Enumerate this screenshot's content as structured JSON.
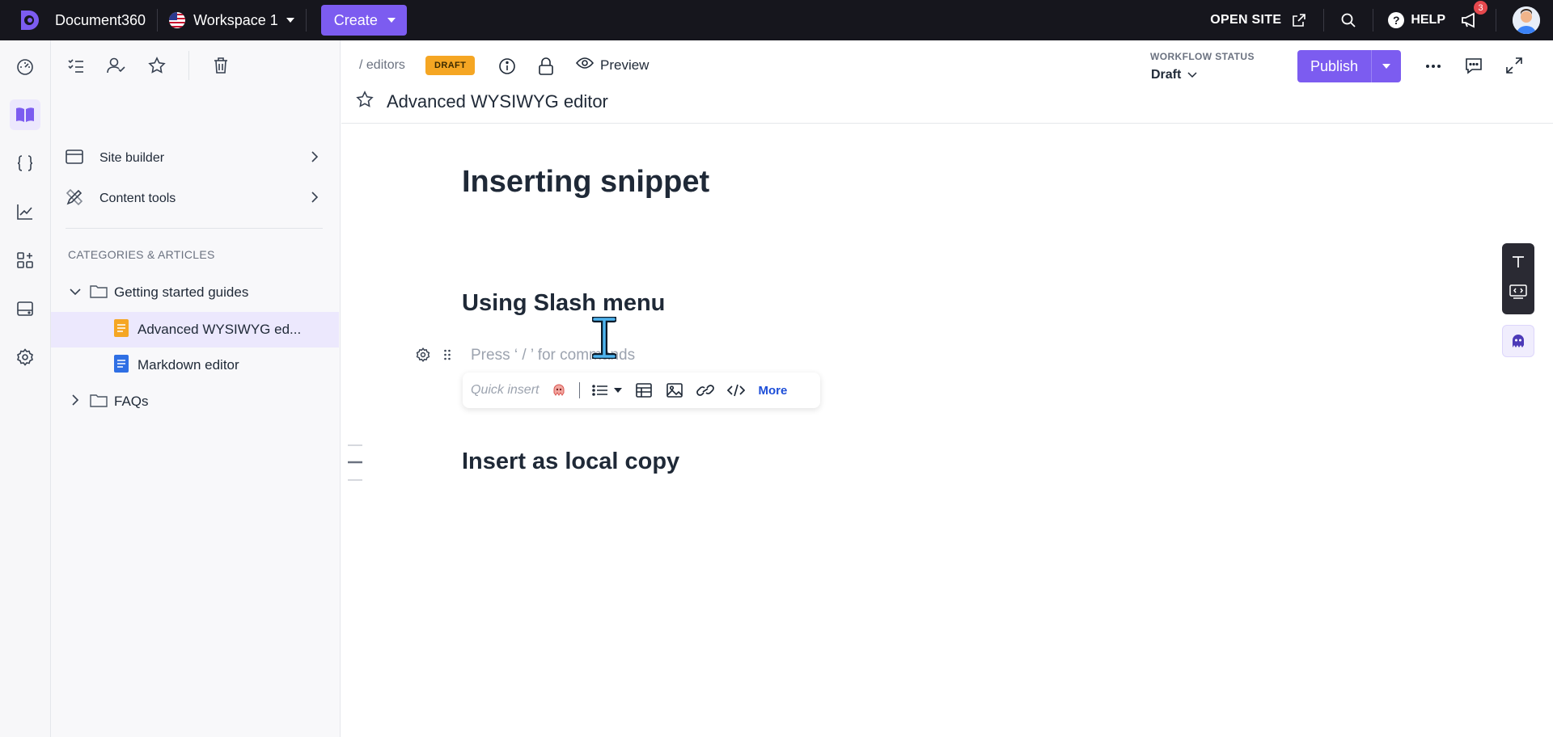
{
  "app": {
    "brand": "Document360",
    "workspace": "Workspace 1",
    "create_label": "Create",
    "open_site_label": "OPEN SITE",
    "help_label": "HELP",
    "notification_count": "3",
    "accent_color": "#7c5cf0"
  },
  "sidebar": {
    "links": [
      {
        "label": "Site builder"
      },
      {
        "label": "Content tools"
      }
    ],
    "categories_heading": "CATEGORIES & ARTICLES",
    "tree": [
      {
        "label": "Getting started guides",
        "expanded": true
      },
      {
        "label": "Advanced WYSIWYG ed...",
        "selected": true
      },
      {
        "label": "Markdown editor"
      },
      {
        "label": "FAQs",
        "expanded": false
      }
    ]
  },
  "header": {
    "breadcrumb": "/ editors",
    "status_badge": "DRAFT",
    "preview_label": "Preview",
    "workflow_status_label": "WORKFLOW STATUS",
    "workflow_status_value": "Draft",
    "publish_label": "Publish",
    "article_title": "Advanced WYSIWYG editor"
  },
  "editor": {
    "heading1": "Inserting snippet",
    "heading2_a": "Using Slash menu",
    "placeholder": "Press ‘ / ’ for commands",
    "quick_insert_label": "Quick insert",
    "more_label": "More",
    "heading2_b": "Insert as local copy"
  }
}
